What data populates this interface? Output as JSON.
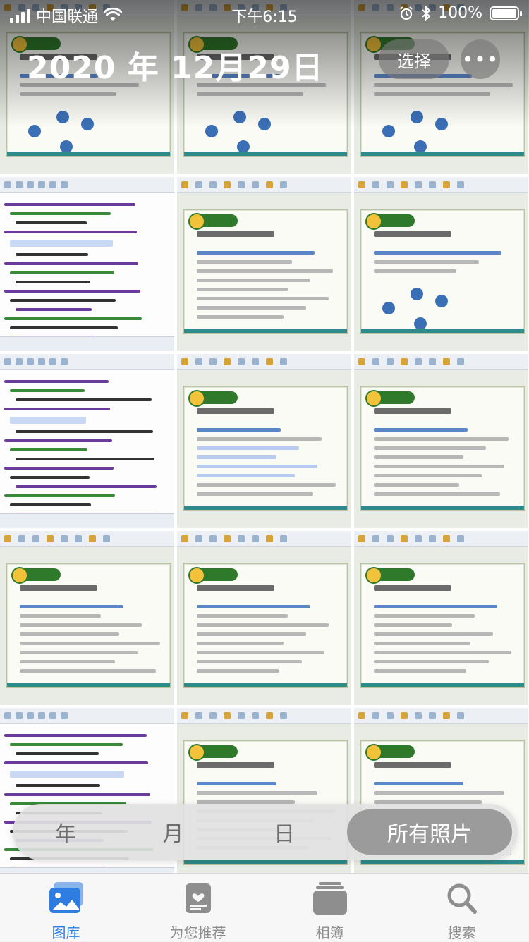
{
  "status_bar": {
    "carrier": "中国联通",
    "time": "下午6:15",
    "battery": "100%",
    "battery_level": 1.0,
    "icons": [
      "signal-icon",
      "wifi-icon",
      "alarm-icon",
      "bluetooth-icon",
      "battery-icon"
    ]
  },
  "header": {
    "date_title": "2020 年 12月29日",
    "select_label": "选择",
    "more_label": "•••"
  },
  "grid": {
    "columns": 3,
    "photos": [
      {
        "kind": "slide",
        "theme": "graph"
      },
      {
        "kind": "slide",
        "theme": "graph-arrow"
      },
      {
        "kind": "slide",
        "theme": "graph-matrix"
      },
      {
        "kind": "code"
      },
      {
        "kind": "slide",
        "theme": "text"
      },
      {
        "kind": "slide",
        "theme": "graph"
      },
      {
        "kind": "code"
      },
      {
        "kind": "slide",
        "theme": "text-selected"
      },
      {
        "kind": "slide",
        "theme": "text"
      },
      {
        "kind": "slide",
        "theme": "text"
      },
      {
        "kind": "slide",
        "theme": "text"
      },
      {
        "kind": "slide",
        "theme": "text"
      },
      {
        "kind": "code"
      },
      {
        "kind": "slide",
        "theme": "text"
      },
      {
        "kind": "slide",
        "theme": "table"
      }
    ]
  },
  "segmented_control": {
    "items": [
      {
        "label": "年",
        "active": false
      },
      {
        "label": "月",
        "active": false
      },
      {
        "label": "日",
        "active": false
      },
      {
        "label": "所有照片",
        "active": true
      }
    ]
  },
  "tab_bar": {
    "items": [
      {
        "label": "图库",
        "icon": "photos-icon",
        "active": true
      },
      {
        "label": "为您推荐",
        "icon": "for-you-icon",
        "active": false
      },
      {
        "label": "相簿",
        "icon": "albums-icon",
        "active": false
      },
      {
        "label": "搜索",
        "icon": "search-icon",
        "active": false
      }
    ]
  },
  "colors": {
    "accent": "#2f7de1",
    "inactive": "#8e8e8e"
  }
}
